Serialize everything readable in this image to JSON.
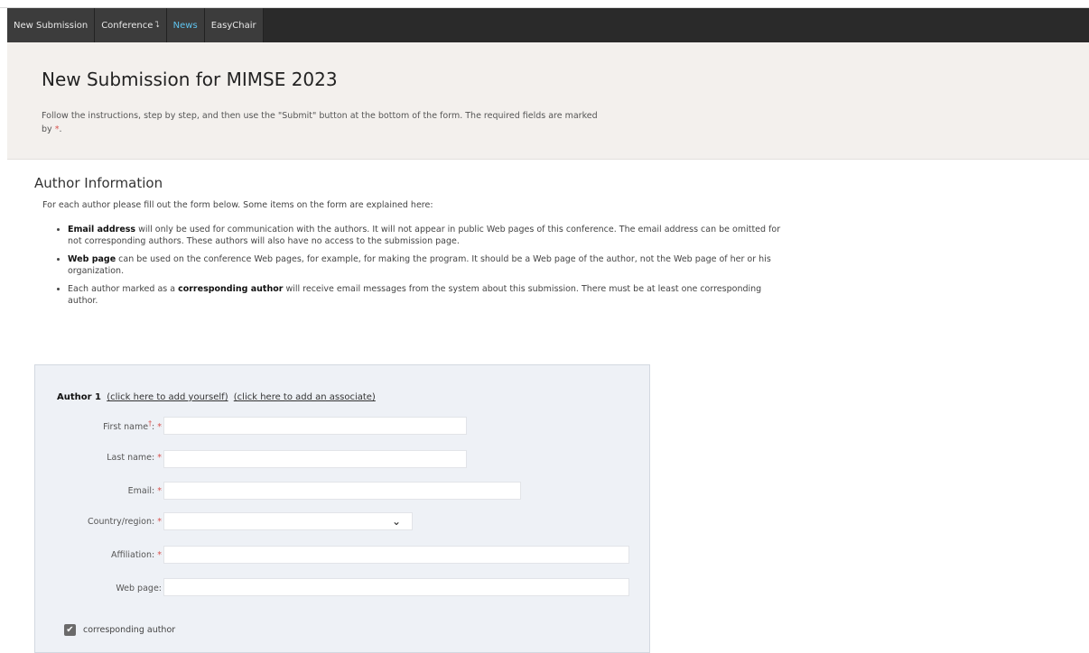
{
  "menu": {
    "items": [
      {
        "label": "New Submission"
      },
      {
        "label": "Conference"
      },
      {
        "label": "News"
      },
      {
        "label": "EasyChair"
      }
    ]
  },
  "header": {
    "title": "New Submission for MIMSE 2023",
    "instructions_main": "Follow the instructions, step by step, and then use the \"Submit\" button at the bottom of the form. The required fields are marked",
    "instructions_by": "by",
    "required_mark": "*",
    "instructions_end": "."
  },
  "author_info": {
    "title": "Author Information",
    "intro": "For each author please fill out the form below. Some items on the form are explained here:",
    "bullets": [
      {
        "bold": "Email address",
        "text": " will only be used for communication with the authors. It will not appear in public Web pages of this conference. The email address can be omitted for not corresponding authors. These authors will also have no access to the submission page."
      },
      {
        "bold": "Web page",
        "text": " can be used on the conference Web pages, for example, for making the program. It should be a Web page of the author, not the Web page of her or his organization."
      },
      {
        "pre": "Each author marked as a ",
        "bold": "corresponding author",
        "text": " will receive email messages from the system about this submission. There must be at least one corresponding author."
      }
    ]
  },
  "author_form": {
    "heading": "Author 1",
    "add_yourself": "(click here to add yourself)",
    "add_associate": "(click here to add an associate)",
    "fields": {
      "first_name": {
        "label": "First name",
        "sup": "†",
        "colon": ":",
        "required": "*",
        "value": ""
      },
      "last_name": {
        "label": "Last name:",
        "required": "*",
        "value": ""
      },
      "email": {
        "label": "Email:",
        "required": "*",
        "value": ""
      },
      "country": {
        "label": "Country/region:",
        "required": "*",
        "value": ""
      },
      "affiliation": {
        "label": "Affiliation:",
        "required": "*",
        "value": ""
      },
      "web_page": {
        "label": "Web page:",
        "value": ""
      }
    },
    "corresponding_label": "corresponding author",
    "corresponding_checked": true
  }
}
